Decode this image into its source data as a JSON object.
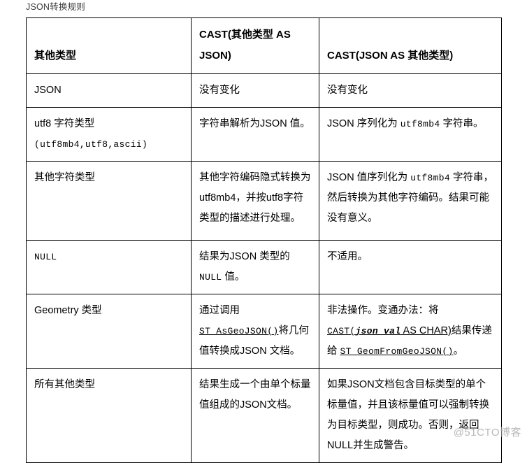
{
  "page": {
    "title": "JSON转换规则",
    "watermark": "@51CTO博客"
  },
  "table": {
    "headers": {
      "col1": "其他类型",
      "col2": "CAST(其他类型 AS JSON)",
      "col3": "CAST(JSON AS 其他类型)"
    },
    "rows": [
      {
        "key": "json",
        "col1_plain": "JSON",
        "col2_plain": "没有变化",
        "col3_plain": "没有变化",
        "col1_parts": [
          {
            "t": "JSON",
            "s": "normal"
          }
        ],
        "col2_parts": [
          {
            "t": "没有变化",
            "s": "normal"
          }
        ],
        "col3_parts": [
          {
            "t": "没有变化",
            "s": "normal"
          }
        ]
      },
      {
        "key": "utf8",
        "col1_plain": "utf8 字符类型 (utf8mb4,utf8,ascii)",
        "col2_plain": "字符串解析为JSON 值。",
        "col3_plain": "JSON 序列化为 utf8mb4 字符串。",
        "col1_parts": [
          {
            "t": "utf8 字符类型 ",
            "s": "normal"
          },
          {
            "t": "(",
            "s": "mono"
          },
          {
            "t": "utf8mb4,utf8,ascii",
            "s": "mono"
          },
          {
            "t": ")",
            "s": "mono"
          }
        ],
        "col2_parts": [
          {
            "t": "字符串解析为JSON 值。",
            "s": "normal"
          }
        ],
        "col3_parts": [
          {
            "t": "JSON 序列化为 ",
            "s": "normal"
          },
          {
            "t": "utf8mb4",
            "s": "mono"
          },
          {
            "t": " 字符串。",
            "s": "normal"
          }
        ]
      },
      {
        "key": "otherchar",
        "col1_plain": "其他字符类型",
        "col2_plain": "其他字符编码隐式转换为utf8mb4，并按utf8字符类型的描述进行处理。",
        "col3_plain": "JSON 值序列化为 utf8mb4 字符串，然后转换为其他字符编码。结果可能没有意义。",
        "col1_parts": [
          {
            "t": "其他字符类型",
            "s": "normal"
          }
        ],
        "col2_parts": [
          {
            "t": "其他字符编码隐式转换为utf8mb4，并按utf8字符类型的描述进行处理。",
            "s": "normal"
          }
        ],
        "col3_parts": [
          {
            "t": "JSON 值序列化为 ",
            "s": "normal"
          },
          {
            "t": "utf8mb4",
            "s": "mono"
          },
          {
            "t": " 字符串，然后转换为其他字符编码。结果可能没有意义。",
            "s": "normal"
          }
        ]
      },
      {
        "key": "null",
        "col1_plain": "NULL",
        "col2_plain": "结果为JSON 类型的 NULL 值。",
        "col3_plain": "不适用。",
        "col1_parts": [
          {
            "t": "NULL",
            "s": "mono"
          }
        ],
        "col2_parts": [
          {
            "t": "结果为JSON 类型的 ",
            "s": "normal"
          },
          {
            "t": "NULL",
            "s": "mono"
          },
          {
            "t": " 值。",
            "s": "normal"
          }
        ],
        "col3_parts": [
          {
            "t": "不适用。",
            "s": "normal"
          }
        ]
      },
      {
        "key": "geometry",
        "col1_plain": "Geometry 类型",
        "col2_plain": "通过调用ST_AsGeoJSON()将几何值转换成JSON 文档。",
        "col3_plain": "非法操作。变通办法：将 CAST(json_val AS CHAR) 结果传递给 ST_GeomFromGeoJSON()。",
        "col1_parts": [
          {
            "t": "Geometry 类型",
            "s": "normal"
          }
        ],
        "col2_parts": [
          {
            "t": "通过调用",
            "s": "normal"
          },
          {
            "t": "ST_AsGeoJSON()",
            "s": "link"
          },
          {
            "t": "将几何值转换成JSON 文档。",
            "s": "normal"
          }
        ],
        "col3_parts": [
          {
            "t": "非法操作。变通办法：将 ",
            "s": "normal"
          },
          {
            "t": "CAST(",
            "s": "link"
          },
          {
            "t": "json_val",
            "s": "link-italic"
          },
          {
            "t": " AS CHAR)",
            "s": "link-plain"
          },
          {
            "t": "结果传递给 ",
            "s": "normal"
          },
          {
            "t": "ST_GeomFromGeoJSON()",
            "s": "link"
          },
          {
            "t": "。",
            "s": "normal"
          }
        ]
      },
      {
        "key": "allother",
        "col1_plain": "所有其他类型",
        "col2_plain": "结果生成一个由单个标量值组成的JSON文档。",
        "col3_plain": "如果JSON文档包含目标类型的单个标量值，并且该标量值可以强制转换为目标类型，则成功。否则，返回NULL并生成警告。",
        "col1_parts": [
          {
            "t": "所有其他类型",
            "s": "normal"
          }
        ],
        "col2_parts": [
          {
            "t": "结果生成一个由单个标量值组成的JSON文档。",
            "s": "normal"
          }
        ],
        "col3_parts": [
          {
            "t": "如果JSON文档包含目标类型的单个标量值，并且该标量值可以强制转换为目标类型，则成功。否则，返回NULL并生成警告。",
            "s": "normal"
          }
        ]
      }
    ]
  }
}
